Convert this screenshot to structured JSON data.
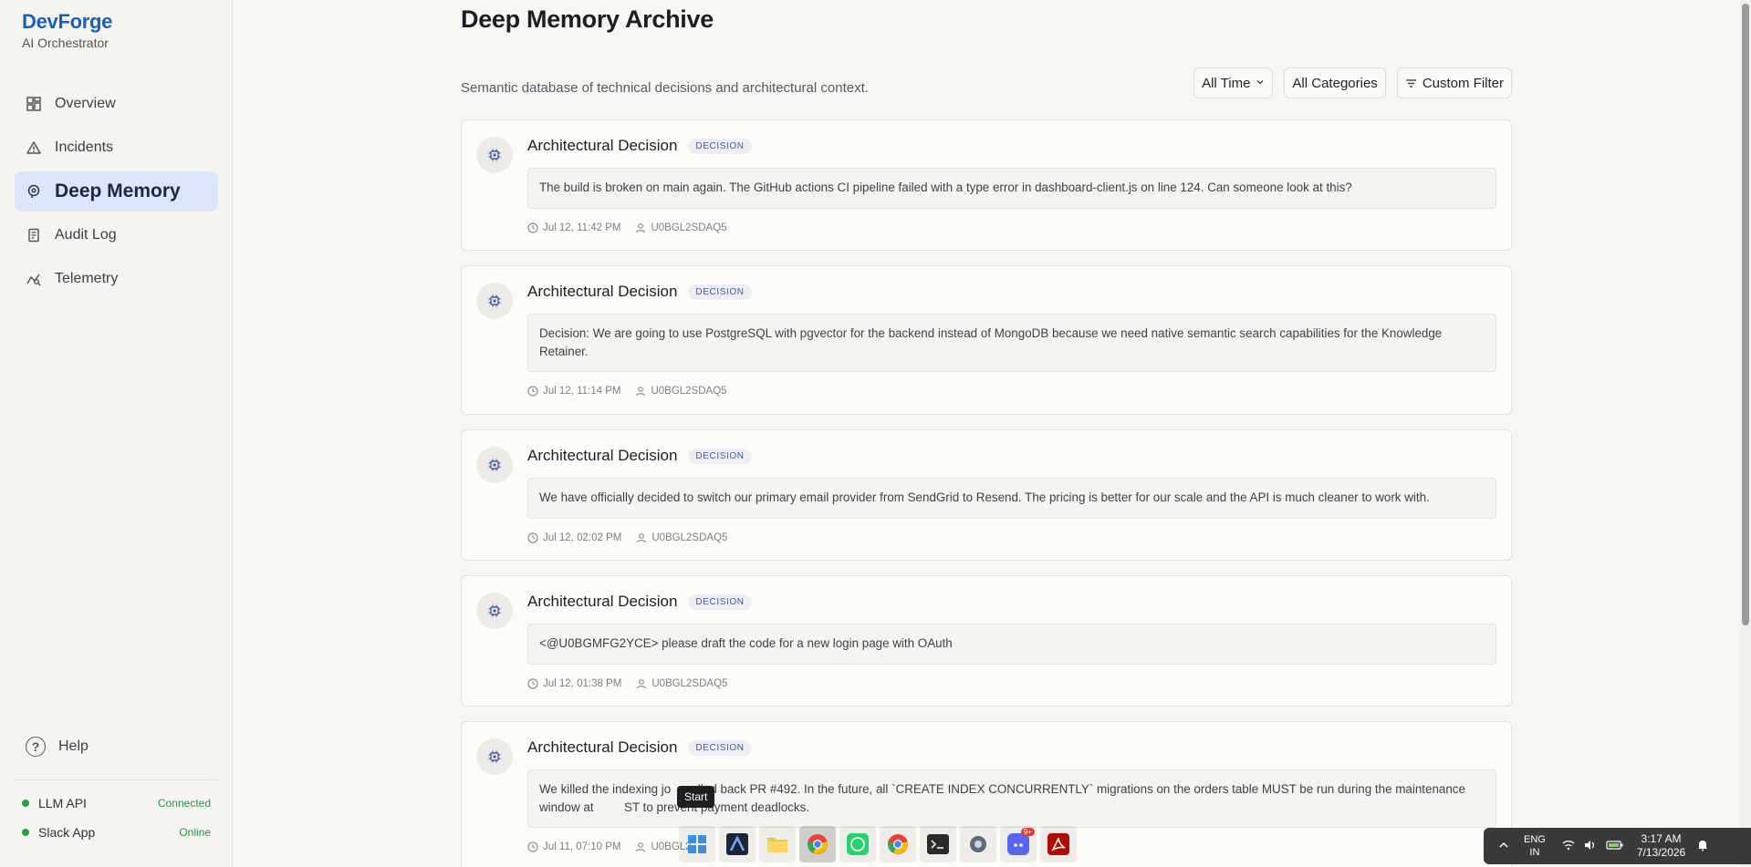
{
  "brand": {
    "name": "DevForge",
    "subtitle": "AI Orchestrator"
  },
  "nav": [
    {
      "label": "Overview",
      "icon": "grid-icon",
      "active": false
    },
    {
      "label": "Incidents",
      "icon": "warning-icon",
      "active": false
    },
    {
      "label": "Deep Memory",
      "icon": "brain-icon",
      "active": true
    },
    {
      "label": "Audit Log",
      "icon": "log-icon",
      "active": false
    },
    {
      "label": "Telemetry",
      "icon": "telemetry-icon",
      "active": false
    }
  ],
  "help_label": "Help",
  "status": [
    {
      "label": "LLM API",
      "state": "Connected"
    },
    {
      "label": "Slack App",
      "state": "Online"
    }
  ],
  "page": {
    "title": "Deep Memory Archive",
    "description": "Semantic database of technical decisions and architectural context."
  },
  "filters": {
    "time": "All Time",
    "category": "All Categories",
    "custom": "Custom Filter"
  },
  "memories": [
    {
      "title": "Architectural Decision",
      "tag": "DECISION",
      "text": "The build is broken on main again. The GitHub actions CI pipeline failed with a type error in dashboard-client.js on line 124. Can someone look at this?",
      "time": "Jul 12, 11:42 PM",
      "user": "U0BGL2SDAQ5"
    },
    {
      "title": "Architectural Decision",
      "tag": "DECISION",
      "text": "Decision: We are going to use PostgreSQL with pgvector for the backend instead of MongoDB because we need native semantic search capabilities for the Knowledge Retainer.",
      "time": "Jul 12, 11:14 PM",
      "user": "U0BGL2SDAQ5"
    },
    {
      "title": "Architectural Decision",
      "tag": "DECISION",
      "text": "We have officially decided to switch our primary email provider from SendGrid to Resend. The pricing is better for our scale and the API is much cleaner to work with.",
      "time": "Jul 12, 02:02 PM",
      "user": "U0BGL2SDAQ5"
    },
    {
      "title": "Architectural Decision",
      "tag": "DECISION",
      "text": "<@U0BGMFG2YCE> please draft the code for a new login page with OAuth",
      "time": "Jul 12, 01:38 PM",
      "user": "U0BGL2SDAQ5"
    },
    {
      "title": "Architectural Decision",
      "tag": "DECISION",
      "text": "We killed the indexing jo      olled back PR #492. In the future, all `CREATE INDEX CONCURRENTLY` migrations on the orders table MUST be run during the maintenance window at         ST to prevent payment deadlocks.",
      "time": "Jul 11, 07:10 PM",
      "user": "U0BGL2"
    }
  ],
  "taskbar": {
    "tooltip": "Start",
    "apps": [
      "start-icon",
      "arc-icon",
      "file-explorer-icon",
      "chrome-icon",
      "whatsapp-icon",
      "chrome-icon",
      "terminal-icon",
      "settings-icon",
      "discord-icon",
      "acrobat-icon"
    ],
    "discord_badge": "9+",
    "lang_top": "ENG",
    "lang_bottom": "IN",
    "time": "3:17 AM",
    "date": "7/13/2026"
  }
}
